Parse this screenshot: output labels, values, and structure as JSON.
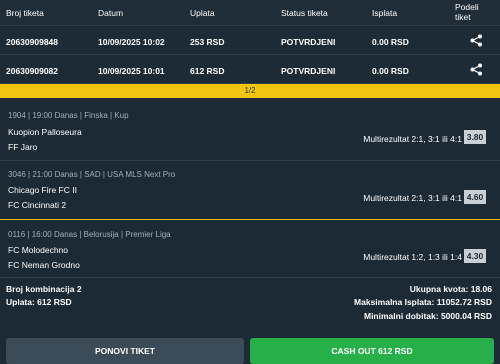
{
  "header": {
    "broj_tiketa": "Broj tiketa",
    "datum": "Datum",
    "uplata": "Uplata",
    "status": "Status tiketa",
    "isplata": "Isplata",
    "podeli_1": "Podeli",
    "podeli_2": "tiket"
  },
  "tickets": [
    {
      "id": "20630909848",
      "date": "10/09/2025 10:02",
      "stake": "253 RSD",
      "status": "POTVRDJENI",
      "payout": "0.00 RSD",
      "share_icon": "share-icon"
    },
    {
      "id": "20630909082",
      "date": "10/09/2025 10:01",
      "stake": "612 RSD",
      "status": "POTVRDJENI",
      "payout": "0.00 RSD",
      "share_icon": "share-icon"
    }
  ],
  "pager": "1/2",
  "matches": [
    {
      "meta": "1904 | 19:00 Danas | Finska | Kup",
      "home": "Kuopion Palloseura",
      "away": "FF Jaro",
      "pick": "Multirezultat 2:1, 3:1 ili 4:1",
      "odd": "3.80"
    },
    {
      "meta": "3046 | 21:00 Danas | SAD | USA MLS Next Pro",
      "home": "Chicago Fire FC II",
      "away": "FC Cincinnati 2",
      "pick": "Multirezultat 2:1, 3:1 ili 4:1",
      "odd": "4.60"
    },
    {
      "meta": "0116 | 16:00 Danas | Belorusija | Premier Liga",
      "home": "FC Molodechno",
      "away": "FC Neman Grodno",
      "pick": "Multirezultat 1:2, 1:3 ili 1:4",
      "odd": "4.30"
    }
  ],
  "summary": {
    "kombinacija": "Broj kombinacija 2",
    "uplata": "Uplata: 612 RSD",
    "kvota": "Ukupna kvota: 18.06",
    "max_isplata": "Maksimalna Isplata: 11052.72 RSD",
    "min_dobitak": "Minimalni dobitak: 5000.04 RSD"
  },
  "buttons": {
    "ponovi": "PONOVI TIKET",
    "cashout": "CASH OUT 612 RSD"
  },
  "colors": {
    "background": "#1b2a35",
    "pager": "#f1c40f",
    "cashout": "#27b04a",
    "ponovi": "#3b4b57",
    "odd_badge": "#c9d0d5"
  }
}
